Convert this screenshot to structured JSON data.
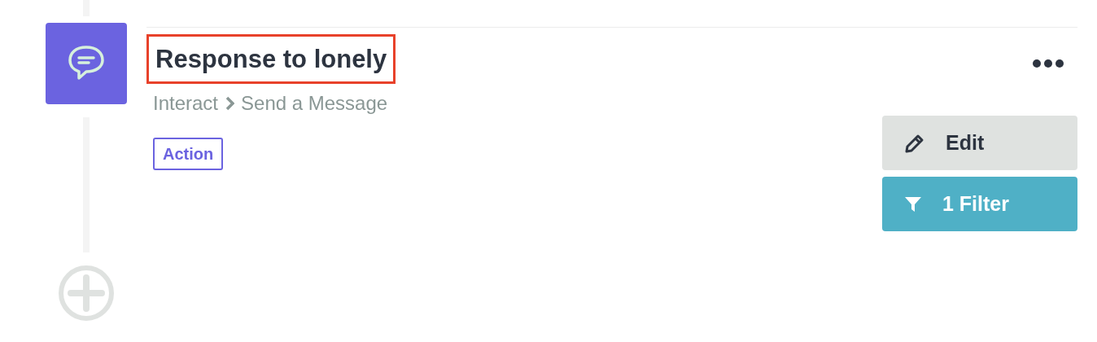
{
  "step": {
    "title": "Response to lonely",
    "highlighted": true,
    "breadcrumb": [
      "Interact",
      "Send a Message"
    ],
    "tag": "Action"
  },
  "buttons": [
    {
      "kind": "edit",
      "label": "Edit"
    },
    {
      "kind": "filter",
      "label": "1 Filter"
    }
  ]
}
